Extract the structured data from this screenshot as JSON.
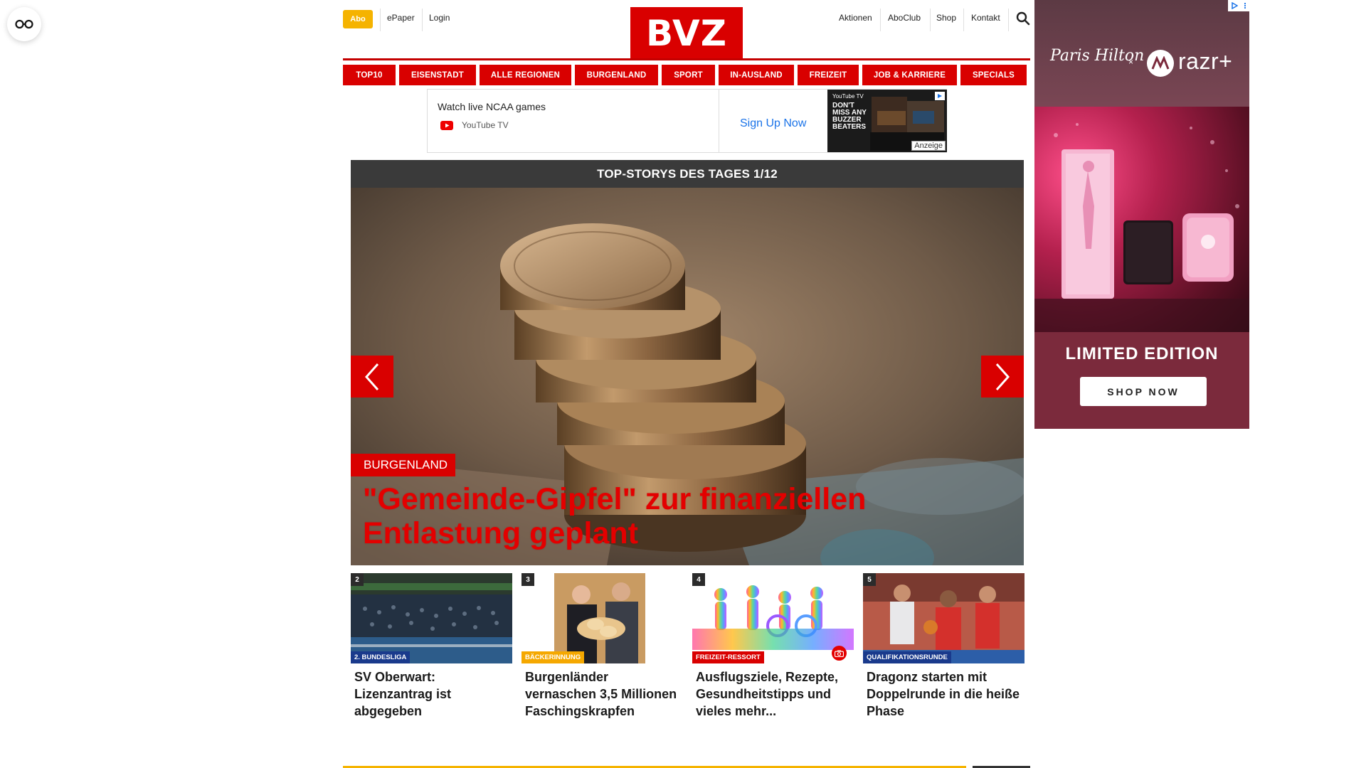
{
  "header": {
    "abo": "Abo",
    "links_left": [
      "ePaper",
      "Login"
    ],
    "logo": "BVZ",
    "links_right": [
      "Aktionen",
      "AboClub",
      "Shop",
      "Kontakt"
    ]
  },
  "nav": {
    "items": [
      "TOP10",
      "EISENSTADT",
      "ALLE REGIONEN",
      "BURGENLAND",
      "SPORT",
      "IN-AUSLAND",
      "FREIZEIT",
      "JOB & KARRIERE",
      "SPECIALS"
    ]
  },
  "ad_banner": {
    "title": "Watch live NCAA games",
    "advertiser": "YouTube TV",
    "cta": "Sign Up Now",
    "thumb_text": "DON'T MISS ANY BUZZER BEATERS",
    "thumb_brand": "YouTube TV",
    "label": "Anzeige"
  },
  "hero": {
    "heading": "TOP-STORYS DES TAGES 1/12",
    "category": "BURGENLAND",
    "title": "\"Gemeinde-Gipfel\" zur finanziellen Entlastung geplant"
  },
  "cards": [
    {
      "num": "2",
      "tag": "2. BUNDESLIGA",
      "tag_color": "#1a3a8c",
      "title": "SV Oberwart: Lizenzantrag ist abgegeben"
    },
    {
      "num": "3",
      "tag": "BÄCKERINNUNG",
      "tag_color": "#f5a800",
      "title": "Burgenländer vernaschen 3,5 Millionen Faschingskrapfen"
    },
    {
      "num": "4",
      "tag": "FREIZEIT-RESSORT",
      "tag_color": "#d90000",
      "title": "Ausflugsziele, Rezepte, Gesundheitstipps und vieles mehr..."
    },
    {
      "num": "5",
      "tag": "QUALIFIKATIONSRUNDE",
      "tag_color": "#1a3a8c",
      "title": "Dragonz starten mit Doppelrunde in die heiße Phase"
    }
  ],
  "side_ad": {
    "script": "Paris Hilton",
    "x": "×",
    "brand": "razr+",
    "headline": "LIMITED EDITION",
    "cta": "SHOP NOW"
  },
  "colors": {
    "brand_red": "#d90000",
    "abo_yellow": "#f5b300",
    "hero_head": "#3a3a3a"
  }
}
